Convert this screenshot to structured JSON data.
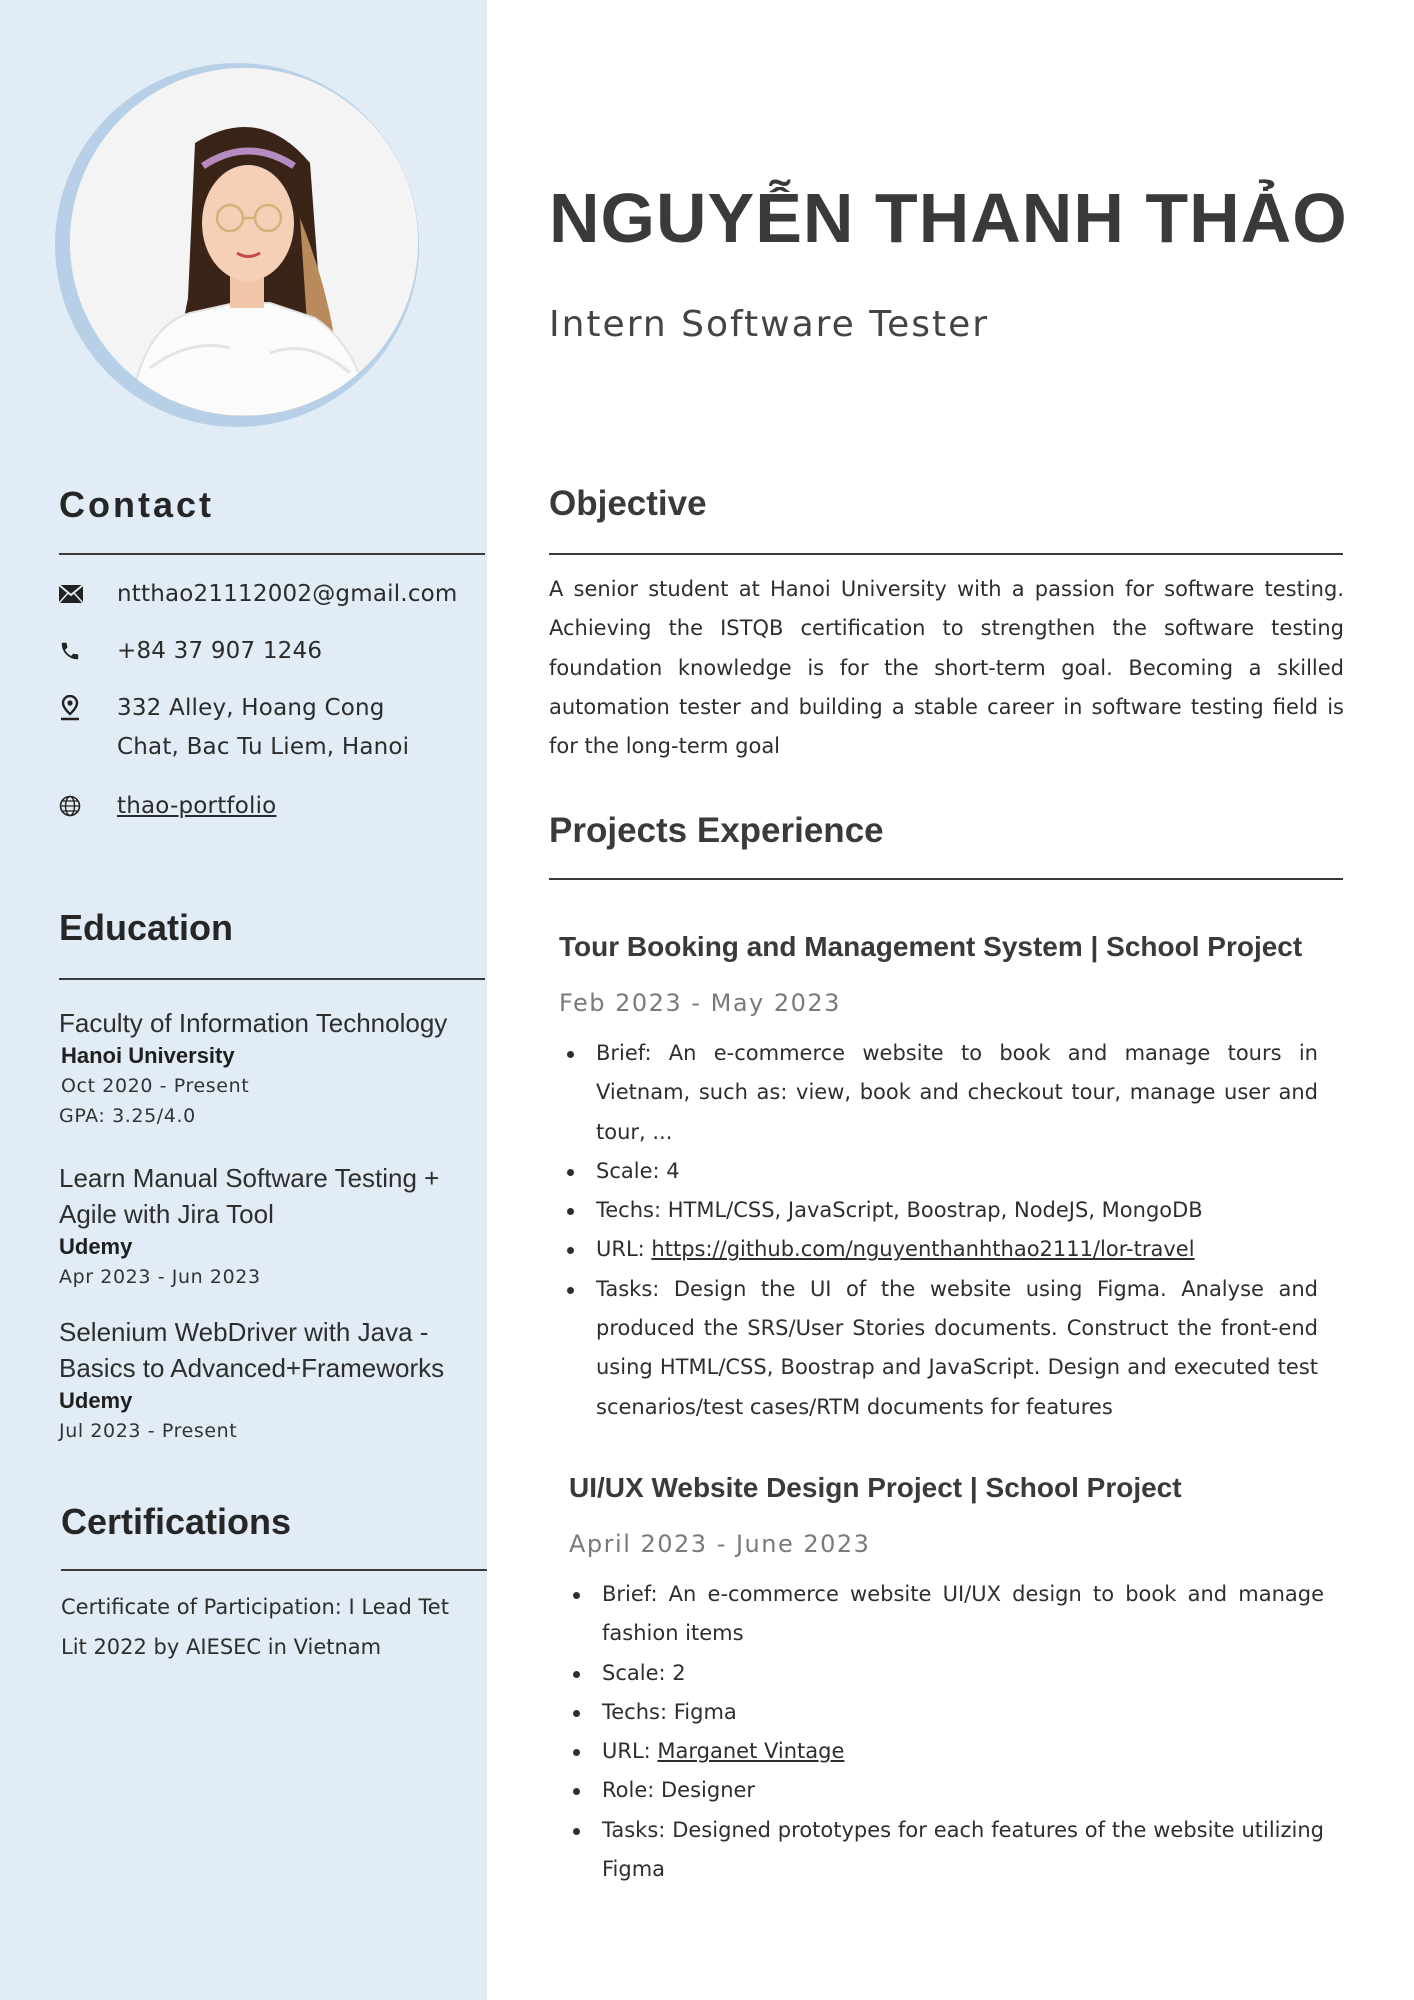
{
  "header": {
    "name": "NGUYỄN THANH THẢO",
    "role": "Intern Software Tester"
  },
  "contact": {
    "heading": "Contact",
    "email": "ntthao21112002@gmail.com",
    "phone": "+84 37 907 1246",
    "address_line1": "332 Alley, Hoang Cong",
    "address_line2": "Chat, Bac Tu Liem, Hanoi",
    "portfolio": "thao-portfolio"
  },
  "education": {
    "heading": "Education",
    "items": [
      {
        "title": "Faculty of Information Technology",
        "org": "Hanoi University",
        "date": "Oct 2020 - Present",
        "extra": "GPA: 3.25/4.0"
      },
      {
        "title": "Learn Manual Software Testing + Agile with Jira Tool",
        "org": "Udemy",
        "date": "Apr 2023 - Jun 2023"
      },
      {
        "title": "Selenium WebDriver with Java - Basics to Advanced+Frameworks",
        "org": "Udemy",
        "date": "Jul 2023 - Present"
      }
    ]
  },
  "certifications": {
    "heading": "Certifications",
    "text": "Certificate of Participation: I Lead Tet Lit 2022 by AIESEC in Vietnam"
  },
  "objective": {
    "heading": "Objective",
    "text": "A senior student at Hanoi University with a passion for software testing. Achieving the ISTQB certification to strengthen the software testing foundation knowledge is for the short-term goal. Becoming a skilled automation tester and building a stable career in software testing field is for the long-term goal"
  },
  "projects": {
    "heading": "Projects Experience",
    "items": [
      {
        "title": "Tour Booking and Management System | School Project",
        "date": "Feb 2023 - May 2023",
        "brief": "Brief: An e-commerce website to book and manage tours in Vietnam, such as: view, book and checkout tour, manage user and tour, ...",
        "scale": "Scale: 4",
        "techs": "Techs: HTML/CSS, JavaScript, Boostrap, NodeJS, MongoDB",
        "url_label": "URL: ",
        "url": "https://github.com/nguyenthanhthao2111/lor-travel",
        "tasks": "Tasks: Design the UI of the website using Figma. Analyse and produced the SRS/User Stories documents. Construct the front-end using HTML/CSS, Boostrap and JavaScript. Design and executed test scenarios/test cases/RTM documents for features"
      },
      {
        "title": "UI/UX Website Design Project | School Project",
        "date": "April 2023 - June 2023",
        "brief": "Brief: An e-commerce website UI/UX design to book and manage fashion items",
        "scale": "Scale: 2",
        "techs": "Techs: Figma",
        "url_label": "URL: ",
        "url": "Marganet Vintage",
        "role": "Role: Designer",
        "tasks": "Tasks: Designed prototypes for each features of the website utilizing Figma"
      }
    ]
  },
  "colors": {
    "sidebar": "#e2ecf6",
    "photo_ring": "#b7cfe7",
    "heading": "#3a3a3a",
    "date_gray": "#7a7a7a"
  },
  "icons": [
    "email-icon",
    "phone-icon",
    "location-icon",
    "globe-icon"
  ]
}
